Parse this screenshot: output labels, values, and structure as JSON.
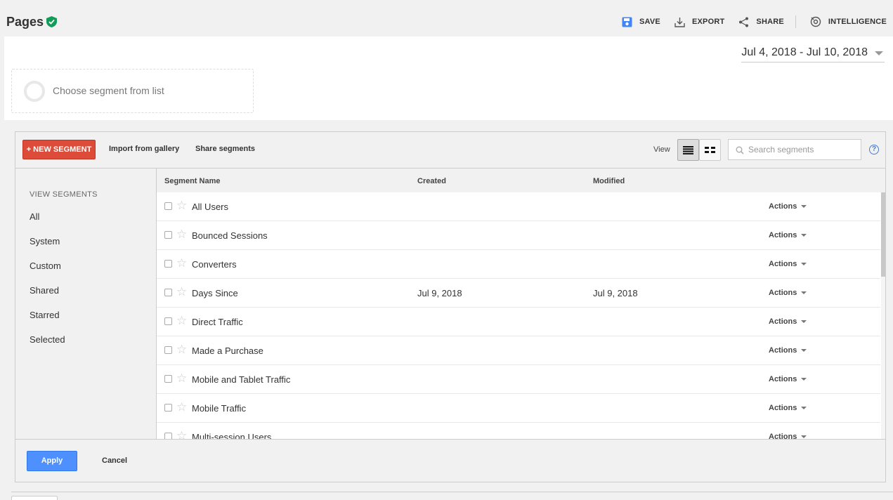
{
  "header": {
    "title": "Pages",
    "save_label": "SAVE",
    "export_label": "EXPORT",
    "share_label": "SHARE",
    "intelligence_label": "INTELLIGENCE"
  },
  "date_range": "Jul 4, 2018 - Jul 10, 2018",
  "segment_slot": {
    "placeholder": "Choose segment from list"
  },
  "editor": {
    "new_segment_label": "+ NEW SEGMENT",
    "import_label": "Import from gallery",
    "share_segments_label": "Share segments",
    "view_label": "View",
    "search_placeholder": "Search segments",
    "help_label": "?",
    "sidebar": {
      "title": "VIEW SEGMENTS",
      "items": [
        "All",
        "System",
        "Custom",
        "Shared",
        "Starred",
        "Selected"
      ]
    },
    "columns": {
      "name": "Segment Name",
      "created": "Created",
      "modified": "Modified"
    },
    "rows": [
      {
        "name": "All Users",
        "created": "",
        "modified": "",
        "actions": "Actions"
      },
      {
        "name": "Bounced Sessions",
        "created": "",
        "modified": "",
        "actions": "Actions"
      },
      {
        "name": "Converters",
        "created": "",
        "modified": "",
        "actions": "Actions"
      },
      {
        "name": "Days Since",
        "created": "Jul 9, 2018",
        "modified": "Jul 9, 2018",
        "actions": "Actions"
      },
      {
        "name": "Direct Traffic",
        "created": "",
        "modified": "",
        "actions": "Actions"
      },
      {
        "name": "Made a Purchase",
        "created": "",
        "modified": "",
        "actions": "Actions"
      },
      {
        "name": "Mobile and Tablet Traffic",
        "created": "",
        "modified": "",
        "actions": "Actions"
      },
      {
        "name": "Mobile Traffic",
        "created": "",
        "modified": "",
        "actions": "Actions"
      },
      {
        "name": "Multi-session Users",
        "created": "",
        "modified": "",
        "actions": "Actions"
      }
    ],
    "apply_label": "Apply",
    "cancel_label": "Cancel"
  },
  "colors": {
    "verified_green": "#0f9d58",
    "save_blue": "#4285f4",
    "new_segment_red": "#dd4b39",
    "apply_blue": "#4d90fe"
  },
  "icons": [
    "verified-shield-icon",
    "save-icon",
    "export-icon",
    "share-icon",
    "intelligence-icon",
    "list-view-icon",
    "grid-view-icon",
    "search-icon",
    "star-icon",
    "checkbox"
  ]
}
